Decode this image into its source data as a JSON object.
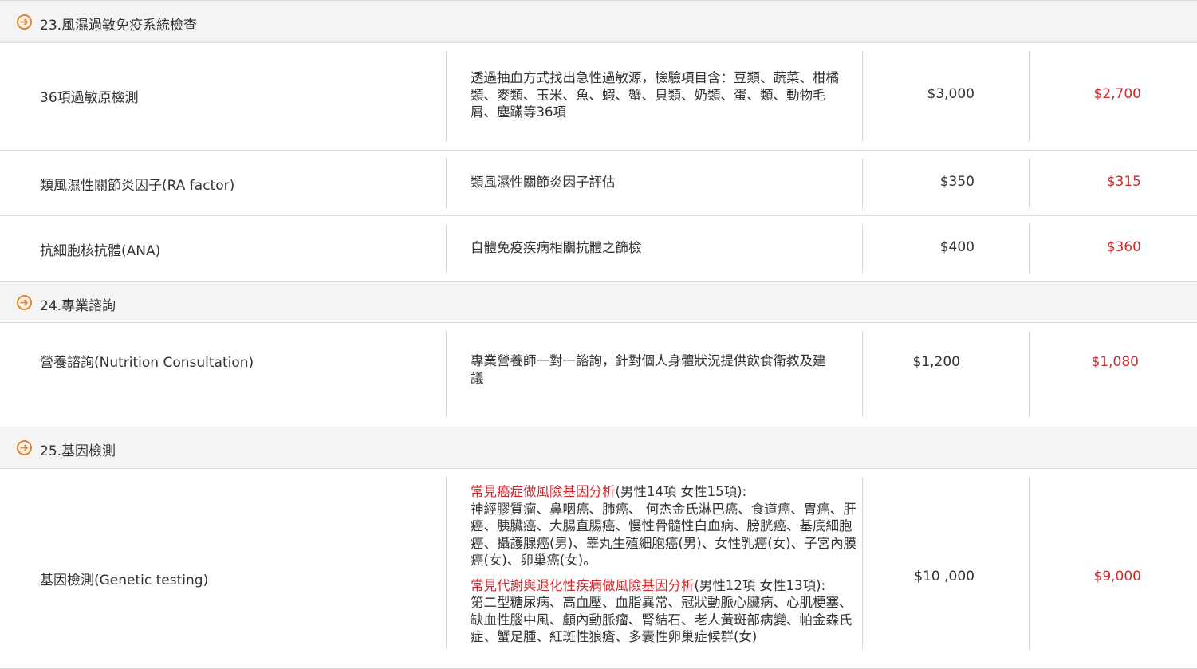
{
  "colors": {
    "accent": "#e8832a",
    "sale": "#d0282d",
    "text": "#333333",
    "header_bg": "#f4f4f4"
  },
  "sections": [
    {
      "title": "23.風濕過敏免疫系統檢查",
      "icon": "arrow-right-circle-icon"
    },
    {
      "title": "24.專業諮詢",
      "icon": "arrow-right-circle-icon"
    },
    {
      "title": "25.基因檢測",
      "icon": "arrow-right-circle-icon"
    }
  ],
  "items": [
    {
      "name": "36項過敏原檢測",
      "desc": "透過抽血方式找出急性過敏源，檢驗項目含：豆類、蔬菜、柑橘類、麥類、玉米、魚、蝦、蟹、貝類、奶類、蛋、類、動物毛屑、塵蹣等36項",
      "price": "$3,000",
      "sale": "$2,700"
    },
    {
      "name": "類風濕性關節炎因子(RA factor)",
      "desc": "類風濕性關節炎因子評估",
      "price": "$350",
      "sale": "$315"
    },
    {
      "name": "抗細胞核抗體(ANA)",
      "desc": "自體免疫疾病相關抗體之篩檢",
      "price": "$400",
      "sale": "$360"
    },
    {
      "name": "營養諮詢(Nutrition Consultation)",
      "desc": "專業營養師一對一諮詢，針對個人身體狀況提供飲食衛教及建議",
      "price": "$1,200",
      "sale": "$1,080"
    },
    {
      "name": "基因檢測(Genetic testing)",
      "desc1_label": "常見癌症做風險基因分析",
      "desc1_suffix": "(男性14項 女性15項):",
      "desc1_body": "神經膠質瘤、鼻咽癌、肺癌、 何杰金氏淋巴癌、食道癌、胃癌、肝癌、胰臟癌、大腸直腸癌、慢性骨髓性白血病、膀胱癌、基底細胞癌、攝護腺癌(男)、睪丸生殖細胞癌(男)、女性乳癌(女)、子宮內膜癌(女)、卵巢癌(女)。",
      "desc2_label": "常見代謝與退化性疾病做風險基因分析",
      "desc2_suffix": "(男性12項 女性13項):",
      "desc2_body": "第二型糖尿病、高血壓、血脂異常、冠狀動脈心臟病、心肌梗塞、缺血性腦中風、顱內動脈瘤、腎結石、老人黃斑部病變、帕金森氏症、蟹足腫、紅斑性狼瘡、多囊性卵巢症候群(女)",
      "price": "$10 ,000",
      "sale": "$9,000"
    }
  ]
}
